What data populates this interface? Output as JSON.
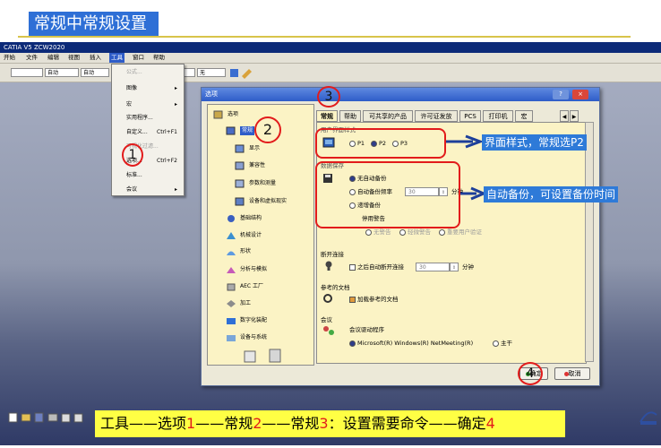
{
  "slide": {
    "title": "常规中常规设置",
    "caption_parts": [
      "工具——选项",
      "1",
      "——常规",
      "2",
      "——常规",
      "3",
      "：设置需要命令——确定",
      "4"
    ]
  },
  "app": {
    "window_title": "CATIA V5 ZCW2020",
    "menus": [
      "开始",
      "文件",
      "编辑",
      "视图",
      "插入",
      "工具",
      "窗口",
      "帮助"
    ],
    "toolbar_combos": [
      "自动",
      "自动",
      "无"
    ],
    "tools_menu": [
      {
        "label": "公式...",
        "shortcut": "",
        "disabled": true
      },
      {
        "label": "图像",
        "shortcut": "",
        "submenu": true
      },
      {
        "label": "宏",
        "shortcut": "",
        "submenu": true
      },
      {
        "label": "实用程序...",
        "shortcut": ""
      },
      {
        "label": "自定义...",
        "shortcut": "Ctrl+F1"
      },
      {
        "label": "可视化过滤...",
        "shortcut": "",
        "disabled": true
      },
      {
        "label": "选项...",
        "shortcut": "Ctrl+F2"
      },
      {
        "label": "标准...",
        "shortcut": ""
      },
      {
        "label": "会议",
        "shortcut": "",
        "submenu": true
      }
    ]
  },
  "dialog": {
    "title": "选项",
    "help_btn": "?",
    "close_btn": "×",
    "tree": [
      {
        "label": "选项"
      },
      {
        "label": "常规"
      },
      {
        "label": "显示"
      },
      {
        "label": "兼容性"
      },
      {
        "label": "参数和测量"
      },
      {
        "label": "设备和虚拟现实"
      },
      {
        "label": "基础结构"
      },
      {
        "label": "机械设计"
      },
      {
        "label": "形状"
      },
      {
        "label": "分析与模拟"
      },
      {
        "label": "AEC 工厂"
      },
      {
        "label": "加工"
      },
      {
        "label": "数字化装配"
      },
      {
        "label": "设备与系统"
      }
    ],
    "tabs": [
      "常规",
      "帮助",
      "可共享的产品",
      "许可证发放",
      "PCS",
      "打印机",
      "宏"
    ],
    "ui_style": {
      "label": "用户界面样式",
      "options": [
        "P1",
        "P2",
        "P3"
      ],
      "selected": "P2"
    },
    "data_save": {
      "label": "数据保存",
      "options": [
        "无自动备份",
        "自动备份频率",
        "递增备份"
      ],
      "selected": "无自动备份",
      "interval_value": "30",
      "interval_unit": "分钟",
      "stop_warning": "停用警告",
      "warning_options": [
        "无警告",
        "轻微警告",
        "重要用户验证"
      ]
    },
    "disconnect": {
      "label": "断开连接",
      "checkbox": "之后自动断开连接",
      "value": "30",
      "unit": "分钟"
    },
    "ref_docs": {
      "label": "参考的文档",
      "checkbox": "加载参考的文档"
    },
    "conference": {
      "label": "会议",
      "driver_label": "会议驱动程序",
      "options": [
        "Microsoft(R) Windows(R) NetMeeting(R)",
        "主干"
      ],
      "selected": "Microsoft(R) Windows(R) NetMeeting(R)"
    },
    "ok_label": "确定",
    "cancel_label": "取消"
  },
  "annotations": {
    "step1": "1",
    "step2": "2",
    "step3": "3",
    "step4": "4",
    "callout_ui": "界面样式，常规选P2",
    "callout_save": "自动备份，可设置备份时间"
  },
  "colors": {
    "accent_red": "#e21b1b",
    "callout_blue": "#2e7ad8",
    "caption_yellow": "#ffff44",
    "title_blue": "#2e6fd6"
  }
}
